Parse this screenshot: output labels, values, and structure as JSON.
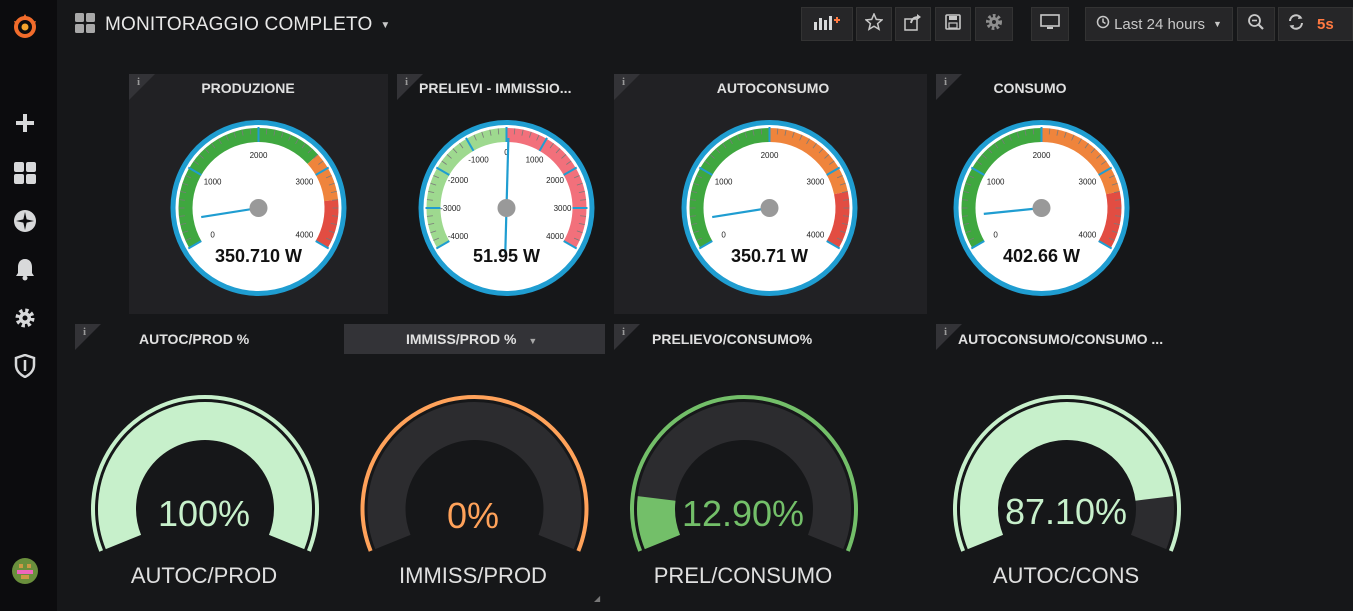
{
  "app": {
    "title": "MONITORAGGIO COMPLETO"
  },
  "toolbar": {
    "time_range": "Last 24 hours",
    "refresh": "5s"
  },
  "colors": {
    "green": "#3fa73f",
    "orange": "#ef843c",
    "red": "#e24d42",
    "blue_ring": "#1f9dd1",
    "light_green": "#c7f0cb",
    "mid_green": "#73bf69",
    "peach": "#ffa25a"
  },
  "panels_top": [
    {
      "title": "PRODUZIONE",
      "value_text": "350.710 W",
      "value": 350.71,
      "min": 0,
      "max": 4000,
      "ticks": [
        "0",
        "1000",
        "2000",
        "3000",
        "4000"
      ]
    },
    {
      "title": "PRELIEVI - IMMISSIO...",
      "value_text": "51.95 W",
      "value": 51.95,
      "min": -4000,
      "max": 4000,
      "ticks": [
        "-4000",
        "-3000",
        "-2000",
        "-1000",
        "0",
        "1000",
        "2000",
        "3000",
        "4000"
      ]
    },
    {
      "title": "AUTOCONSUMO",
      "value_text": "350.71 W",
      "value": 350.71,
      "min": 0,
      "max": 4000,
      "ticks": [
        "0",
        "1000",
        "2000",
        "3000",
        "4000"
      ]
    },
    {
      "title": "CONSUMO",
      "value_text": "402.66 W",
      "value": 402.66,
      "min": 0,
      "max": 4000,
      "ticks": [
        "0",
        "1000",
        "2000",
        "3000",
        "4000"
      ]
    }
  ],
  "panels_bottom": [
    {
      "title": "AUTOC/PROD %",
      "value_text": "100%",
      "fraction": 1.0,
      "label": "AUTOC/PROD"
    },
    {
      "title": "IMMISS/PROD %",
      "value_text": "0%",
      "fraction": 0.0,
      "label": "IMMISS/PROD"
    },
    {
      "title": "PRELIEVO/CONSUMO%",
      "value_text": "12.90%",
      "fraction": 0.129,
      "label": "PREL/CONSUMO"
    },
    {
      "title": "AUTOCONSUMO/CONSUMO ...",
      "value_text": "87.10%",
      "fraction": 0.871,
      "label": "AUTOC/CONS"
    }
  ],
  "icons": {
    "sidebar": [
      "grafana-logo-icon",
      "plus-icon",
      "dashboards-icon",
      "explore-icon",
      "bell-icon",
      "gear-icon",
      "shield-icon",
      "avatar"
    ],
    "toolbar": [
      "add-panel-icon",
      "star-icon",
      "share-icon",
      "save-icon",
      "settings-icon",
      "tv-icon",
      "clock-icon",
      "zoom-out-icon",
      "refresh-icon"
    ]
  }
}
